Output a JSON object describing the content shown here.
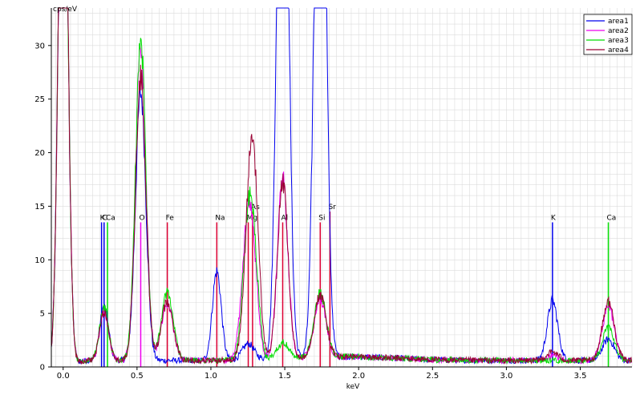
{
  "chart_data": {
    "type": "line",
    "ylabel": "cps/eV",
    "xlabel": "keV",
    "xlim": [
      -0.08,
      3.85
    ],
    "ylim": [
      0,
      33.5
    ],
    "xticks": [
      0.0,
      0.5,
      1.0,
      1.5,
      2.0,
      2.5,
      3.0,
      3.5
    ],
    "xtick_labels": [
      "0.0",
      "0.5",
      "1.0",
      "1.5",
      "2.0",
      "2.5",
      "3.0",
      "3.5"
    ],
    "yticks": [
      0,
      5,
      10,
      15,
      20,
      25,
      30
    ],
    "ytick_labels": [
      "0",
      "5",
      "10",
      "15",
      "20",
      "25",
      "30"
    ],
    "grid": true,
    "legend": "top-right",
    "background": 0.6,
    "series": [
      {
        "name": "area1",
        "color": "#0000ee",
        "peaks": [
          [
            0.0,
            60,
            0.03
          ],
          [
            0.277,
            5,
            0.03
          ],
          [
            0.525,
            25,
            0.035
          ],
          [
            1.04,
            8.3,
            0.03
          ],
          [
            1.253,
            1.5,
            0.04
          ],
          [
            1.486,
            70,
            0.035
          ],
          [
            1.74,
            70,
            0.035
          ],
          [
            3.312,
            5.6,
            0.035
          ],
          [
            3.69,
            2.0,
            0.04
          ]
        ]
      },
      {
        "name": "area2",
        "color": "#ee00ee",
        "peaks": [
          [
            0.0,
            60,
            0.03
          ],
          [
            0.277,
            4.5,
            0.03
          ],
          [
            0.525,
            29,
            0.035
          ],
          [
            0.705,
            5.3,
            0.04
          ],
          [
            1.253,
            13.5,
            0.04
          ],
          [
            1.3,
            3,
            0.03
          ],
          [
            1.486,
            16.8,
            0.035
          ],
          [
            1.74,
            5.4,
            0.04
          ],
          [
            3.312,
            0.5,
            0.04
          ],
          [
            3.69,
            5.0,
            0.04
          ]
        ]
      },
      {
        "name": "area3",
        "color": "#00dd00",
        "peaks": [
          [
            0.0,
            60,
            0.03
          ],
          [
            0.277,
            5,
            0.03
          ],
          [
            0.525,
            30,
            0.035
          ],
          [
            0.705,
            6.3,
            0.04
          ],
          [
            1.253,
            13,
            0.035
          ],
          [
            1.3,
            6,
            0.03
          ],
          [
            1.486,
            1.5,
            0.04
          ],
          [
            1.74,
            6.0,
            0.04
          ],
          [
            3.69,
            3.0,
            0.04
          ]
        ]
      },
      {
        "name": "area4",
        "color": "#990033",
        "peaks": [
          [
            0.0,
            60,
            0.03
          ],
          [
            0.277,
            4.5,
            0.03
          ],
          [
            0.525,
            26.5,
            0.035
          ],
          [
            0.705,
            5.5,
            0.04
          ],
          [
            1.253,
            8,
            0.035
          ],
          [
            1.29,
            15.5,
            0.035
          ],
          [
            1.486,
            16.5,
            0.035
          ],
          [
            1.74,
            5.8,
            0.04
          ],
          [
            3.312,
            0.8,
            0.04
          ],
          [
            3.69,
            5.5,
            0.04
          ]
        ]
      }
    ],
    "peak_markers": [
      {
        "label": "K",
        "energy": 0.26,
        "height": 13.5,
        "color": "#0000ee"
      },
      {
        "label": "C",
        "energy": 0.277,
        "height": 13.5,
        "color": "#0000ee"
      },
      {
        "label": "Ca",
        "energy": 0.3,
        "height": 13.5,
        "color": "#00dd00"
      },
      {
        "label": "O",
        "energy": 0.525,
        "height": 13.5,
        "color": "#ee00ee"
      },
      {
        "label": "Fe",
        "energy": 0.705,
        "height": 13.5,
        "color": "#dd0033"
      },
      {
        "label": "Na",
        "energy": 1.04,
        "height": 13.5,
        "color": "#dd0033"
      },
      {
        "label": "Mg",
        "energy": 1.253,
        "height": 13.5,
        "color": "#dd0033"
      },
      {
        "label": "As",
        "energy": 1.282,
        "height": 14.5,
        "color": "#dd0033"
      },
      {
        "label": "Al",
        "energy": 1.486,
        "height": 13.5,
        "color": "#dd0033"
      },
      {
        "label": "Si",
        "energy": 1.74,
        "height": 13.5,
        "color": "#dd0033"
      },
      {
        "label": "Sr",
        "energy": 1.806,
        "height": 14.5,
        "color": "#dd0033"
      },
      {
        "label": "K",
        "energy": 3.312,
        "height": 13.5,
        "color": "#0000ee"
      },
      {
        "label": "Ca",
        "energy": 3.69,
        "height": 13.5,
        "color": "#00dd00"
      }
    ]
  }
}
